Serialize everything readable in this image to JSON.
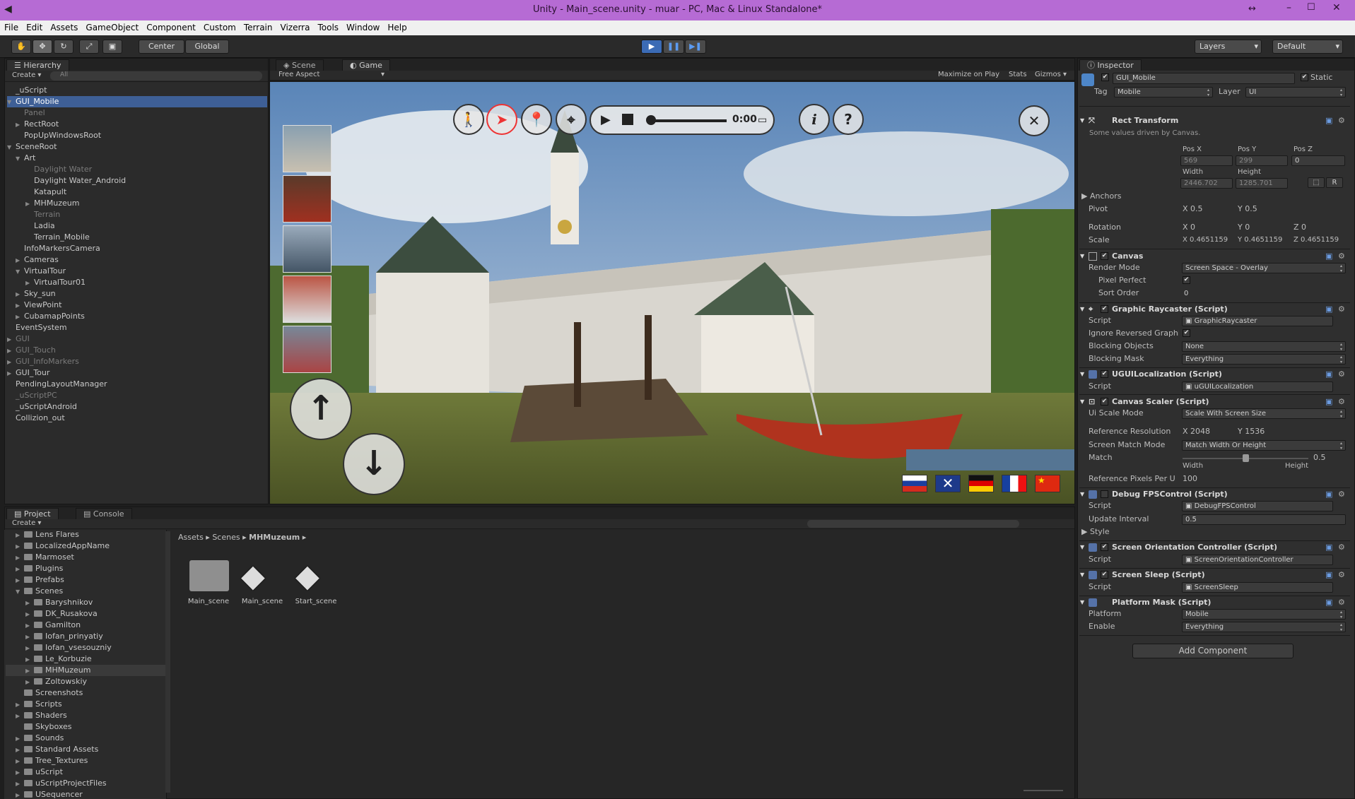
{
  "window": {
    "title": "Unity - Main_scene.unity - muar - PC, Mac & Linux Standalone*"
  },
  "menu": [
    "File",
    "Edit",
    "Assets",
    "GameObject",
    "Component",
    "Custom",
    "Terrain",
    "Vizerra",
    "Tools",
    "Window",
    "Help"
  ],
  "toolbar": {
    "center": "Center",
    "global": "Global",
    "layers": "Layers",
    "layout": "Default"
  },
  "hierarchy": {
    "tab": "Hierarchy",
    "create": "Create",
    "search_placeholder": "All",
    "items": [
      "_uScript",
      "GUI_Mobile",
      "Panel",
      "RectRoot",
      "PopUpWindowsRoot",
      "SceneRoot",
      "Art",
      "Daylight Water",
      "Daylight Water_Android",
      "Katapult",
      "MHMuzeum",
      "Terrain",
      "Ladia",
      "Terrain_Mobile",
      "InfoMarkersCamera",
      "Cameras",
      "VirtualTour",
      "VirtualTour01",
      "Sky_sun",
      "ViewPoint",
      "CubamapPoints",
      "EventSystem",
      "GUI",
      "GUI_Touch",
      "GUI_InfoMarkers",
      "GUI_Tour",
      "PendingLayoutManager",
      "_uScriptPC",
      "_uScriptAndroid",
      "Collizion_out"
    ]
  },
  "scene_tabs": {
    "scene": "Scene",
    "game": "Game"
  },
  "game_bar": {
    "aspect": "Free Aspect",
    "maximize": "Maximize on Play",
    "stats": "Stats",
    "gizmos": "Gizmos"
  },
  "game_view": {
    "time": "0:00",
    "info": "i",
    "help": "?",
    "close": "✕",
    "up": "↑",
    "down": "↓"
  },
  "project": {
    "tab": "Project",
    "console_tab": "Console",
    "create": "Create",
    "breadcrumb": [
      "Assets",
      "Scenes",
      "MHMuzeum"
    ],
    "folders": [
      "Lens Flares",
      "LocalizedAppName",
      "Marmoset",
      "Plugins",
      "Prefabs",
      "Scenes",
      "Baryshnikov",
      "DK_Rusakova",
      "Gamilton",
      "Iofan_prinyatiy",
      "Iofan_vsesouzniy",
      "Le_Korbuzie",
      "MHMuzeum",
      "Zoltowskiy",
      "Screenshots",
      "Scripts",
      "Shaders",
      "Skyboxes",
      "Sounds",
      "Standard Assets",
      "Tree_Textures",
      "uScript",
      "uScriptProjectFiles",
      "USequencer"
    ],
    "assets": [
      "Main_scene",
      "Main_scene",
      "Start_scene"
    ]
  },
  "inspector": {
    "tab": "Inspector",
    "object_name": "GUI_Mobile",
    "static": "Static",
    "tag_label": "Tag",
    "tag": "Mobile",
    "layer_label": "Layer",
    "layer": "UI",
    "rect_transform": {
      "title": "Rect Transform",
      "note": "Some values driven by Canvas.",
      "pos_x_label": "Pos X",
      "pos_y_label": "Pos Y",
      "pos_z_label": "Pos Z",
      "pos_x": "569",
      "pos_y": "299",
      "pos_z": "0",
      "width_label": "Width",
      "height_label": "Height",
      "width": "2446.702",
      "height": "1285.701",
      "r": "R",
      "anchors": "Anchors",
      "pivot": "Pivot",
      "pivot_x": "X  0.5",
      "pivot_y": "Y  0.5",
      "rotation": "Rotation",
      "rot_x": "X  0",
      "rot_y": "Y  0",
      "rot_z": "Z  0",
      "scale": "Scale",
      "scale_x": "X  0.4651159",
      "scale_y": "Y  0.4651159",
      "scale_z": "Z  0.4651159"
    },
    "canvas": {
      "title": "Canvas",
      "render_mode_label": "Render Mode",
      "render_mode": "Screen Space - Overlay",
      "pixel_perfect": "Pixel Perfect",
      "sort_order_label": "Sort Order",
      "sort_order": "0"
    },
    "raycaster": {
      "title": "Graphic Raycaster (Script)",
      "script_label": "Script",
      "script": "GraphicRaycaster",
      "ignore": "Ignore Reversed Graphi",
      "blocking_objects_label": "Blocking Objects",
      "blocking_objects": "None",
      "blocking_mask_label": "Blocking Mask",
      "blocking_mask": "Everything"
    },
    "localization": {
      "title": "UGUILocalization (Script)",
      "script_label": "Script",
      "script": "uGUILocalization"
    },
    "scaler": {
      "title": "Canvas Scaler (Script)",
      "ui_scale_label": "Ui Scale Mode",
      "ui_scale": "Scale With Screen Size",
      "ref_res_label": "Reference Resolution",
      "ref_x": "X  2048",
      "ref_y": "Y  1536",
      "match_mode_label": "Screen Match Mode",
      "match_mode": "Match Width Or Height",
      "match_label": "Match",
      "match_value": "0.5",
      "match_fraction": 0.5,
      "width": "Width",
      "height": "Height",
      "ppu_label": "Reference Pixels Per U",
      "ppu": "100"
    },
    "fps": {
      "title": "Debug FPSControl (Script)",
      "script_label": "Script",
      "script": "DebugFPSControl",
      "interval_label": "Update Interval",
      "interval": "0.5",
      "style": "Style"
    },
    "orientation": {
      "title": "Screen Orientation Controller (Script)",
      "script_label": "Script",
      "script": "ScreenOrientationController"
    },
    "sleep": {
      "title": "Screen Sleep (Script)",
      "script_label": "Script",
      "script": "ScreenSleep"
    },
    "platform": {
      "title": "Platform Mask (Script)",
      "platform_label": "Platform",
      "platform": "Mobile",
      "enable_label": "Enable",
      "enable": "Everything"
    },
    "add_component": "Add Component"
  },
  "colors": {
    "titlebar": "#b66bd4",
    "selection": "#3e5f96",
    "panel": "#2b2b2b"
  }
}
